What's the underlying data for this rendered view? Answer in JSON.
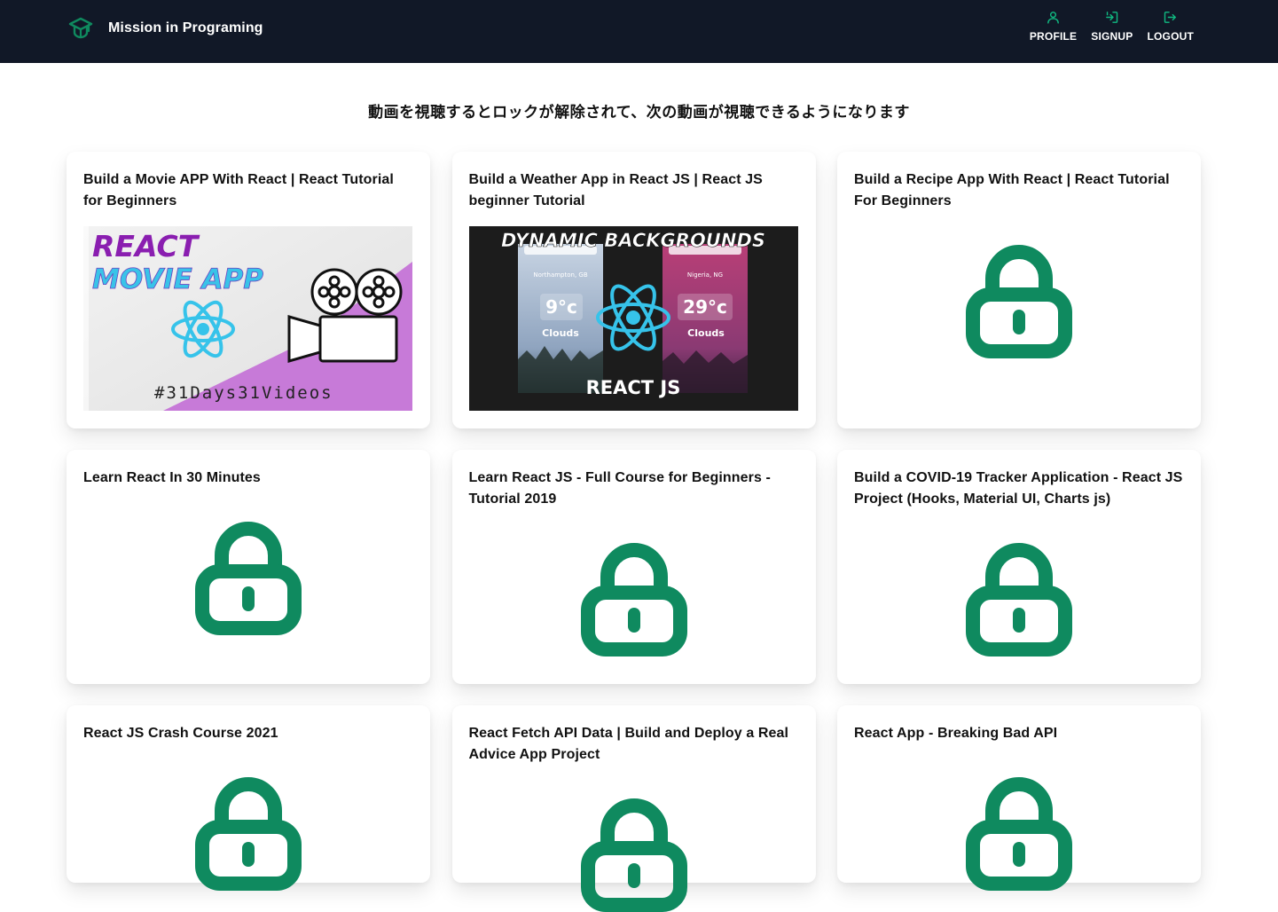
{
  "header": {
    "brand": "Mission in Programing",
    "nav": [
      {
        "label": "PROFILE",
        "icon": "user-icon"
      },
      {
        "label": "SIGNUP",
        "icon": "login-icon"
      },
      {
        "label": "LOGOUT",
        "icon": "logout-icon"
      }
    ]
  },
  "main": {
    "notice": "動画を視聴するとロックが解除されて、次の動画が視聴できるようになります"
  },
  "videos": [
    {
      "title": "Build a Movie APP With React | React Tutorial for Beginners",
      "status": "unlocked",
      "thumbnail": {
        "line1": "REACT",
        "line2": "MOVIE APP",
        "hashtag": "#31Days31Videos"
      }
    },
    {
      "title": "Build a Weather App in React JS | React JS beginner Tutorial",
      "status": "unlocked",
      "thumbnail": {
        "headline": "DYNAMIC BACKGROUNDS",
        "left_city": "Northampton, GB",
        "left_temp": "9°c",
        "left_cond": "Clouds",
        "right_city": "Nigeria, NG",
        "right_temp": "29°c",
        "right_cond": "Clouds",
        "footer": "REACT JS"
      }
    },
    {
      "title": "Build a Recipe App With React | React Tutorial For Beginners",
      "status": "locked"
    },
    {
      "title": "Learn React In 30 Minutes",
      "status": "locked"
    },
    {
      "title": "Learn React JS - Full Course for Beginners - Tutorial 2019",
      "status": "locked"
    },
    {
      "title": "Build a COVID-19 Tracker Application - React JS Project (Hooks, Material UI, Charts js)",
      "status": "locked"
    },
    {
      "title": "React JS Crash Course 2021",
      "status": "locked"
    },
    {
      "title": "React Fetch API Data | Build and Deploy a Real Advice App Project",
      "status": "locked"
    },
    {
      "title": "React App - Breaking Bad API",
      "status": "locked"
    }
  ],
  "colors": {
    "navbar_bg": "#111827",
    "accent_green": "#0f8a5f",
    "text": "#111111"
  }
}
